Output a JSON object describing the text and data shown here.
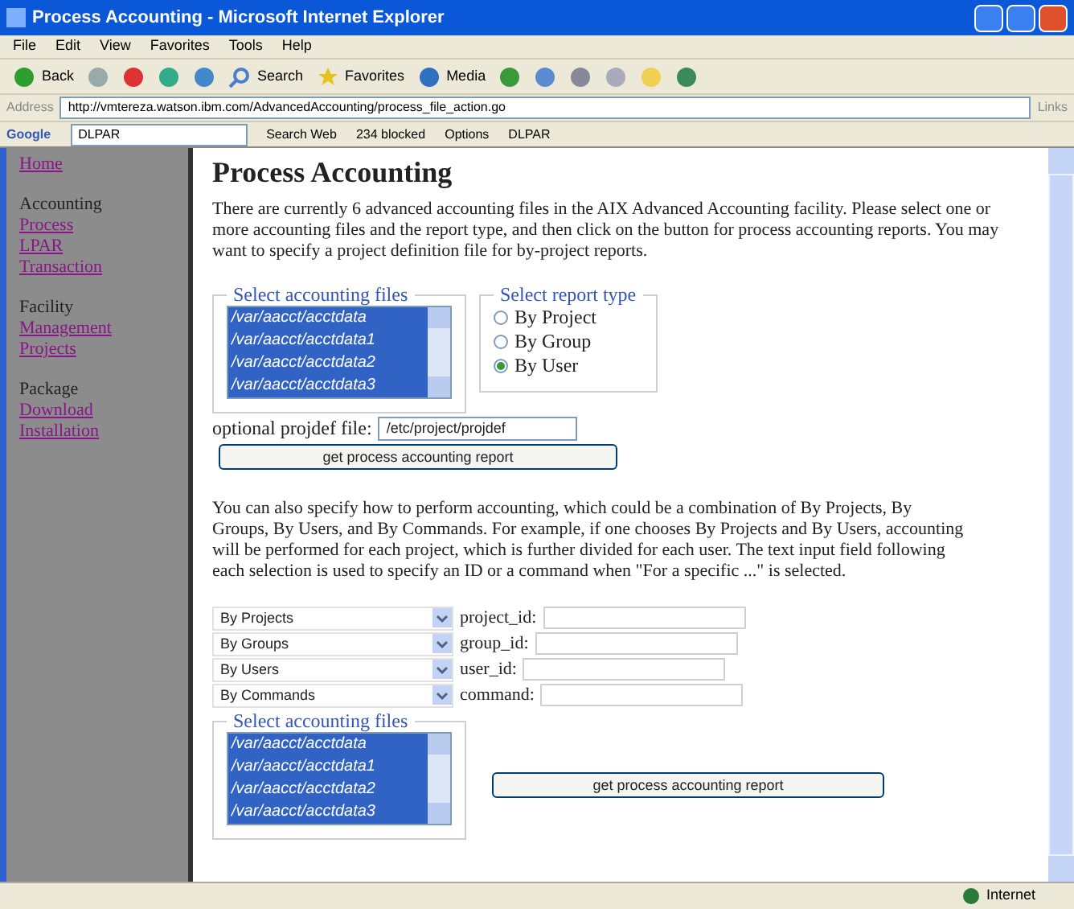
{
  "window": {
    "title": "Process Accounting - Microsoft Internet Explorer"
  },
  "menu": [
    "File",
    "Edit",
    "View",
    "Favorites",
    "Tools",
    "Help"
  ],
  "toolbar": [
    {
      "kind": "back",
      "label": "Back"
    },
    {
      "kind": "forward"
    },
    {
      "kind": "stop"
    },
    {
      "kind": "refresh"
    },
    {
      "kind": "home"
    },
    {
      "kind": "search",
      "label": "Search"
    },
    {
      "kind": "favorites",
      "label": "Favorites"
    },
    {
      "kind": "media",
      "label": "Media"
    },
    {
      "kind": "history"
    },
    {
      "kind": "mail"
    },
    {
      "kind": "print"
    },
    {
      "kind": "edit"
    },
    {
      "kind": "folder"
    },
    {
      "kind": "messenger"
    }
  ],
  "address": {
    "label": "Address",
    "url": "http://vmtereza.watson.ibm.com/AdvancedAccounting/process_file_action.go",
    "links": "Links"
  },
  "google_bar": {
    "logo": "Google",
    "query": "DLPAR",
    "search": "Search Web",
    "blocked": "234 blocked",
    "options": "Options",
    "dlpar": "DLPAR"
  },
  "sidebar": [
    {
      "kind": "link",
      "label": "Home"
    },
    {
      "kind": "heading",
      "label": "Accounting"
    },
    {
      "kind": "link",
      "label": "Process"
    },
    {
      "kind": "link",
      "label": "LPAR"
    },
    {
      "kind": "link",
      "label": "Transaction"
    },
    {
      "kind": "heading",
      "label": "Facility"
    },
    {
      "kind": "link",
      "label": "Management"
    },
    {
      "kind": "link",
      "label": "Projects"
    },
    {
      "kind": "heading",
      "label": "Package"
    },
    {
      "kind": "link",
      "label": "Download"
    },
    {
      "kind": "link",
      "label": "Installation"
    }
  ],
  "page": {
    "title": "Process Accounting",
    "intro": "There are currently 6 advanced accounting files in the AIX Advanced Accounting facility. Please select one or more accounting files and the report type, and then click on the button for process accounting reports. You may want to specify a project definition file for by-project reports.",
    "files1": {
      "legend": "Select accounting files",
      "items": [
        {
          "label": "/var/aacct/acctdata",
          "selected": true
        },
        {
          "label": "/var/aacct/acctdata1",
          "selected": true
        },
        {
          "label": "/var/aacct/acctdata2",
          "selected": true
        },
        {
          "label": "/var/aacct/acctdata3",
          "selected": true
        }
      ]
    },
    "report_type": {
      "legend": "Select report type",
      "options": [
        {
          "label": "By Project",
          "selected": false
        },
        {
          "label": "By Group",
          "selected": false
        },
        {
          "label": "By User",
          "selected": true
        }
      ]
    },
    "projdef": {
      "label": "optional projdef file:",
      "value": "/etc/project/projdef"
    },
    "button1": "get process accounting report",
    "explain": "You can also specify how to perform accounting, which could be a combination of By Projects, By Groups, By Users, and By Commands. For example, if one chooses By Projects and By Users, accounting will be performed for each project, which is further divided for each user. The text input field following each selection is used to specify an ID or a command when \"For a specific ...\" is selected.",
    "criteria": [
      {
        "select": "By Projects",
        "label": "project_id:"
      },
      {
        "select": "By Groups",
        "label": "group_id:"
      },
      {
        "select": "By Users",
        "label": "user_id:"
      },
      {
        "select": "By Commands",
        "label": "command:"
      }
    ],
    "files2": {
      "legend": "Select accounting files",
      "items": [
        {
          "label": "/var/aacct/acctdata",
          "selected": true
        },
        {
          "label": "/var/aacct/acctdata1",
          "selected": true
        },
        {
          "label": "/var/aacct/acctdata2",
          "selected": true
        },
        {
          "label": "/var/aacct/acctdata3",
          "selected": true
        }
      ]
    },
    "button2": "get process accounting report"
  },
  "status_bar": {
    "zone": "Internet"
  }
}
